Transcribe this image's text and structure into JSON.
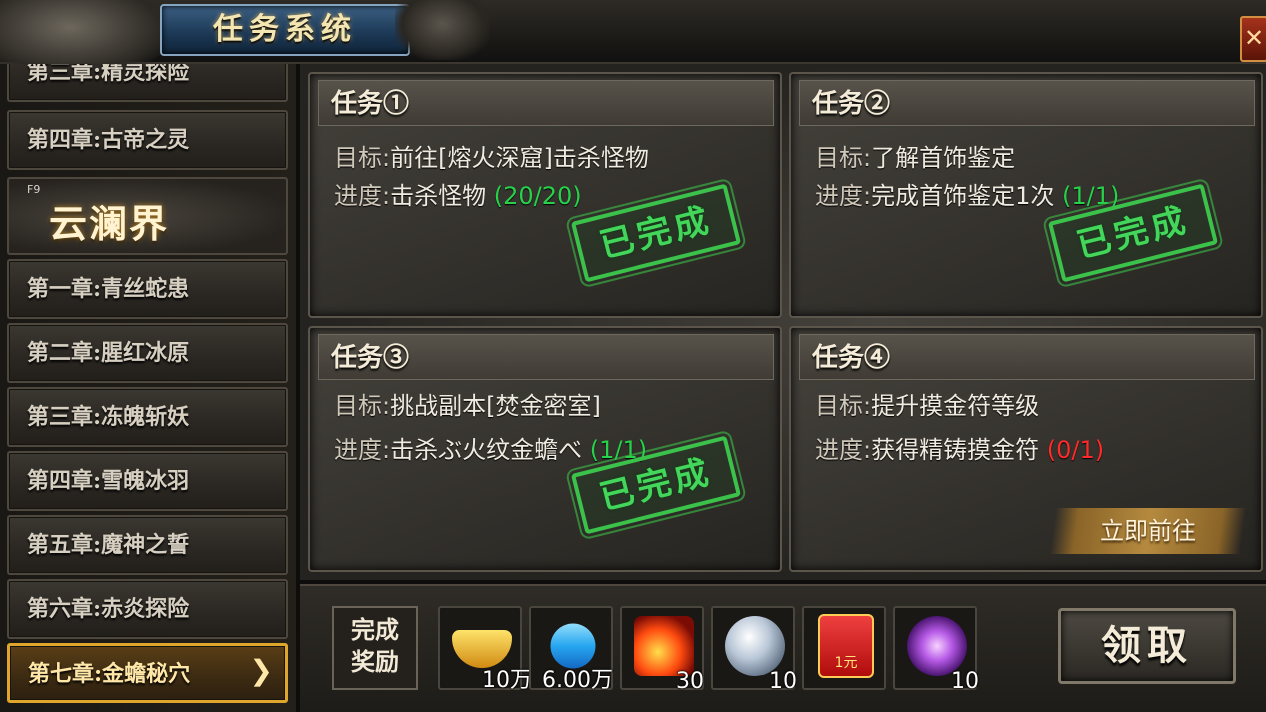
{
  "header": {
    "title": "任务系统",
    "close_label": "✕"
  },
  "sidebar": {
    "chapters_top": [
      {
        "label": "第三章:精灵探险"
      },
      {
        "label": "第四章:古帝之灵"
      }
    ],
    "realm": {
      "hotkey": "F9",
      "name": "云澜界"
    },
    "chapters": [
      {
        "label": "第一章:青丝蛇患"
      },
      {
        "label": "第二章:腥红冰原"
      },
      {
        "label": "第三章:冻魄斩妖"
      },
      {
        "label": "第四章:雪魄冰羽"
      },
      {
        "label": "第五章:魔神之誓"
      },
      {
        "label": "第六章:赤炎探险"
      },
      {
        "label": "第七章:金蟾秘穴",
        "selected": true
      }
    ],
    "selected_arrow": "❯"
  },
  "tasks": [
    {
      "title": "任务①",
      "goal_label": "目标:",
      "goal": "前往[熔火深窟]击杀怪物",
      "progress_label": "进度:",
      "progress_text": "击杀怪物",
      "progress_value": "(20/20)",
      "status_color": "#27d24a",
      "stamp": "已完成"
    },
    {
      "title": "任务②",
      "goal_label": "目标:",
      "goal": "了解首饰鉴定",
      "progress_label": "进度:",
      "progress_text": "完成首饰鉴定1次",
      "progress_value": "(1/1)",
      "status_color": "#27d24a",
      "stamp": "已完成"
    },
    {
      "title": "任务③",
      "goal_label": "目标:",
      "goal": "挑战副本[焚金密室]",
      "progress_label": "进度:",
      "progress_text": "击杀ぶ火纹金蟾べ",
      "progress_value": "(1/1)",
      "status_color": "#27d24a",
      "stamp": "已完成"
    },
    {
      "title": "任务④",
      "goal_label": "目标:",
      "goal": "提升摸金符等级",
      "progress_label": "进度:",
      "progress_text": "获得精铸摸金符",
      "progress_value": "(0/1)",
      "status_color": "#ff2a2a",
      "goto_label": "立即前往"
    }
  ],
  "rewards": {
    "label": "完成\n奖励",
    "items": [
      {
        "icon": "gold-ingot-icon",
        "count": "10万"
      },
      {
        "icon": "diamond-icon",
        "count": "6.00万"
      },
      {
        "icon": "fire-feather-icon",
        "count": "30"
      },
      {
        "icon": "spirit-stone-icon",
        "count": "10"
      },
      {
        "icon": "red-packet-icon",
        "count": "",
        "packet_text": "1元"
      },
      {
        "icon": "purple-orb-icon",
        "count": "10"
      }
    ],
    "claim_label": "领取"
  }
}
